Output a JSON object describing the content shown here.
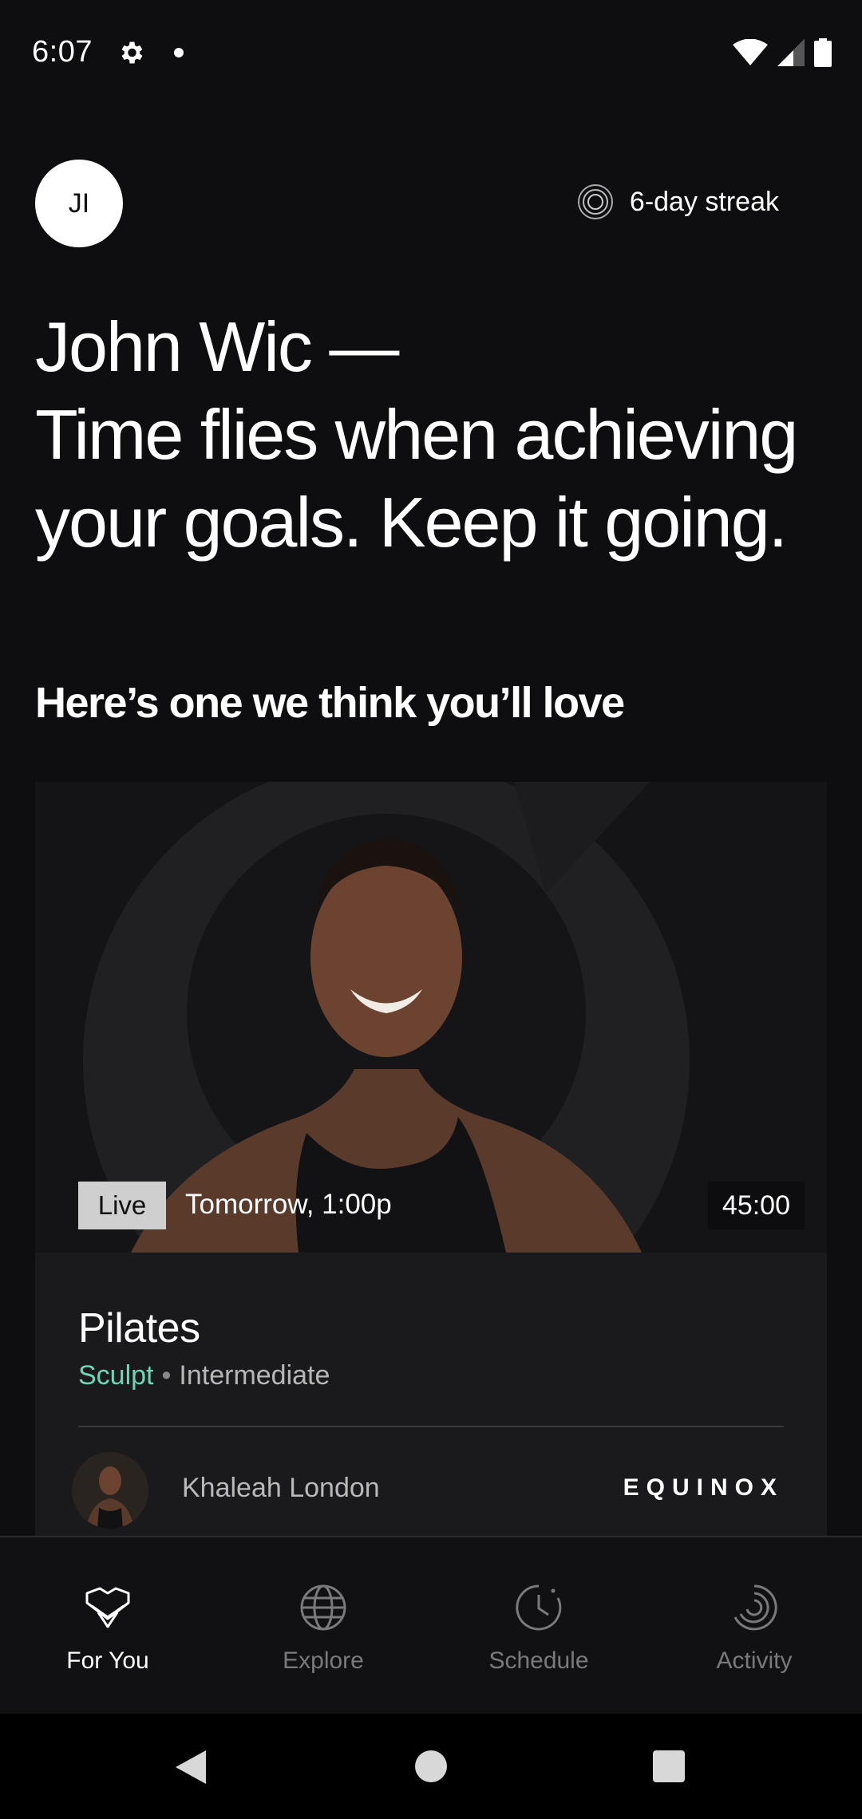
{
  "status_bar": {
    "time": "6:07",
    "icons": [
      "gear-icon",
      "notification-dot-icon",
      "wifi-icon",
      "cell-signal-icon",
      "battery-icon"
    ]
  },
  "header": {
    "avatar_initials": "JI",
    "streak_label": "6-day streak",
    "streak_icon": "concentric-rings-icon"
  },
  "headline": {
    "name_line": "John Wic —",
    "message": "Time flies when achieving your goals. Keep it going."
  },
  "section": {
    "title": "Here’s one we think you’ll love"
  },
  "featured_class": {
    "live_badge": "Live",
    "scheduled_time": "Tomorrow, 1:00p",
    "duration": "45:00",
    "title": "Pilates",
    "category": "Sculpt",
    "separator": "•",
    "level": "Intermediate",
    "instructor": "Khaleah London",
    "brand": "EQUINOX",
    "category_color": "#6fd6b4"
  },
  "bottom_nav": {
    "items": [
      {
        "label": "For You",
        "icon": "heart-chevron-icon",
        "active": true
      },
      {
        "label": "Explore",
        "icon": "globe-icon",
        "active": false
      },
      {
        "label": "Schedule",
        "icon": "clock-icon",
        "active": false
      },
      {
        "label": "Activity",
        "icon": "activity-rings-icon",
        "active": false
      }
    ]
  },
  "system_nav": {
    "icons": [
      "back-icon",
      "home-icon",
      "recents-icon"
    ]
  }
}
